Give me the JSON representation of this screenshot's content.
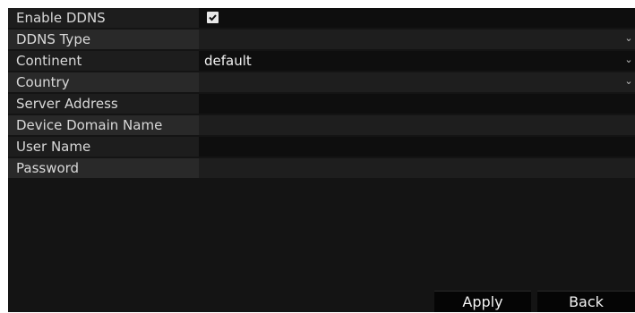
{
  "form": {
    "enable_ddns": {
      "label": "Enable DDNS",
      "checked": true
    },
    "ddns_type": {
      "label": "DDNS Type",
      "value": ""
    },
    "continent": {
      "label": "Continent",
      "value": "default"
    },
    "country": {
      "label": "Country",
      "value": ""
    },
    "server_address": {
      "label": "Server Address",
      "value": ""
    },
    "device_domain_name": {
      "label": "Device Domain Name",
      "value": ""
    },
    "user_name": {
      "label": "User Name",
      "value": ""
    },
    "password": {
      "label": "Password",
      "value": ""
    }
  },
  "buttons": {
    "apply": "Apply",
    "back": "Back"
  },
  "icons": {
    "dropdown": "chevron-down-icon",
    "check": "check-icon"
  }
}
